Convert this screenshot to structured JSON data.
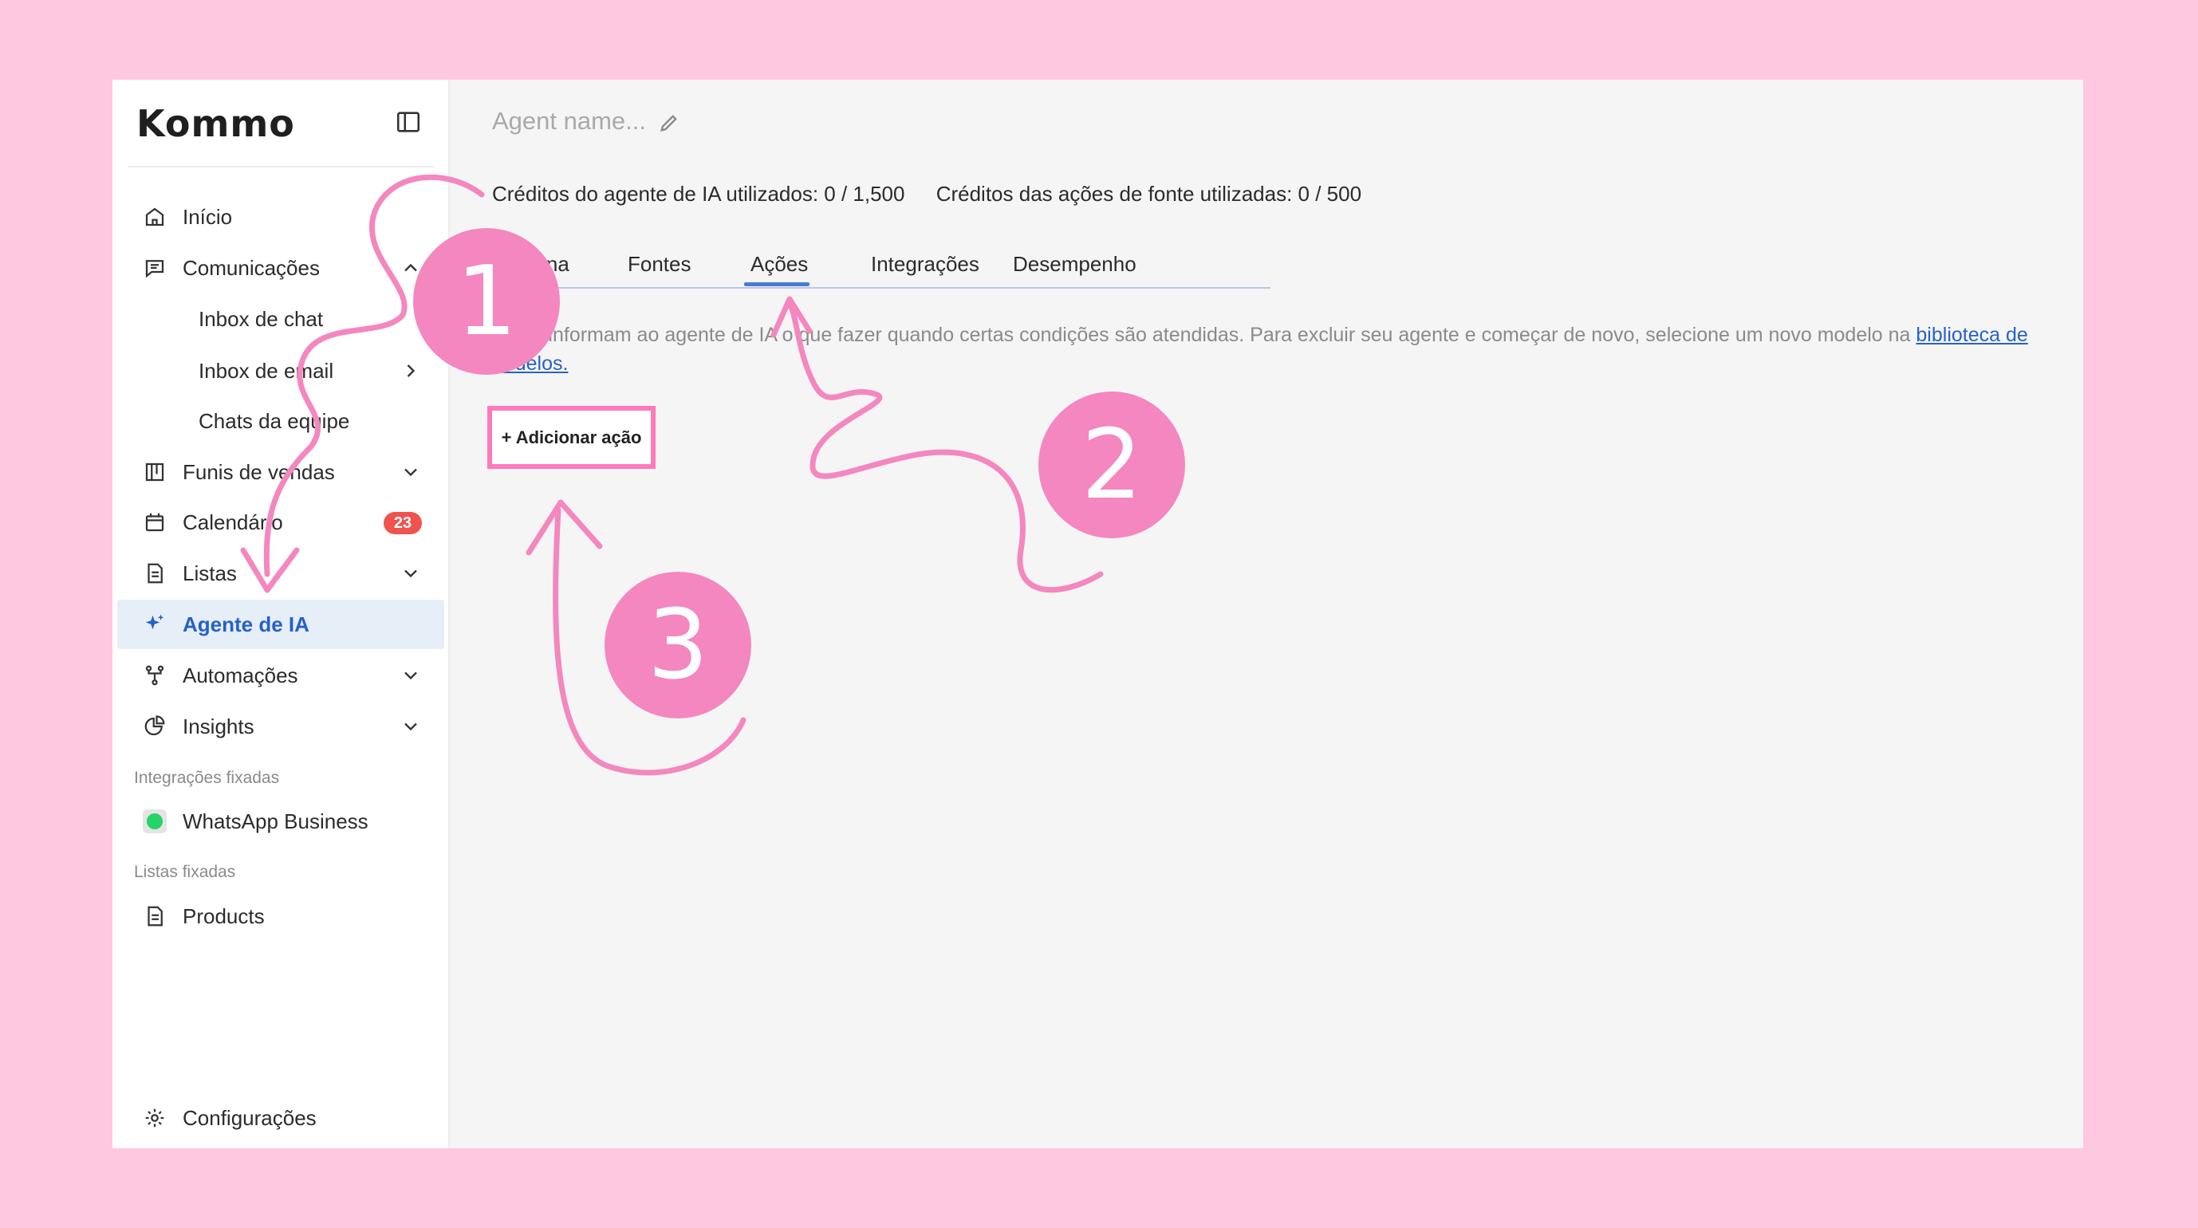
{
  "sidebar": {
    "logo": "Kommo",
    "items": [
      {
        "label": "Início",
        "icon": "home-icon"
      },
      {
        "label": "Comunicações",
        "icon": "chat-icon"
      },
      {
        "label": "Inbox de chat"
      },
      {
        "label": "Inbox de email"
      },
      {
        "label": "Chats da equipe"
      },
      {
        "label": "Funis de vendas",
        "icon": "pipeline-icon"
      },
      {
        "label": "Calendário",
        "icon": "calendar-icon",
        "badge": "23"
      },
      {
        "label": "Listas",
        "icon": "list-icon"
      },
      {
        "label": "Agente de IA",
        "icon": "sparkle-icon"
      },
      {
        "label": "Automações",
        "icon": "automation-icon"
      },
      {
        "label": "Insights",
        "icon": "pie-chart-icon"
      }
    ],
    "pinned_integrations_label": "Integrações fixadas",
    "whatsapp": "WhatsApp Business",
    "pinned_lists_label": "Listas fixadas",
    "products": "Products",
    "settings": "Configurações"
  },
  "main": {
    "title_placeholder": "Agent name...",
    "credits_ai": "Créditos do agente de IA utilizados:  0 / 1,500",
    "credits_source": "Créditos das ações de fonte utilizadas:  0 / 500",
    "tabs": [
      "Persona",
      "Fontes",
      "Ações",
      "Integrações",
      "Desempenho"
    ],
    "active_tab": "Ações",
    "description": "Ações informam ao agente de IA o que fazer quando certas condições são atendidas. Para excluir seu agente e começar de novo, selecione um novo modelo na ",
    "description_link": "biblioteca de modelos.",
    "add_action": "+ Adicionar ação"
  },
  "annotations": {
    "step1": "1",
    "step2": "2",
    "step3": "3",
    "color": "#f487bf"
  },
  "colors": {
    "background": "#ffc8e1",
    "accent": "#2761c8",
    "active_bg": "#e6eef8",
    "highlight": "#ff79bd",
    "badge": "#f0524e"
  }
}
